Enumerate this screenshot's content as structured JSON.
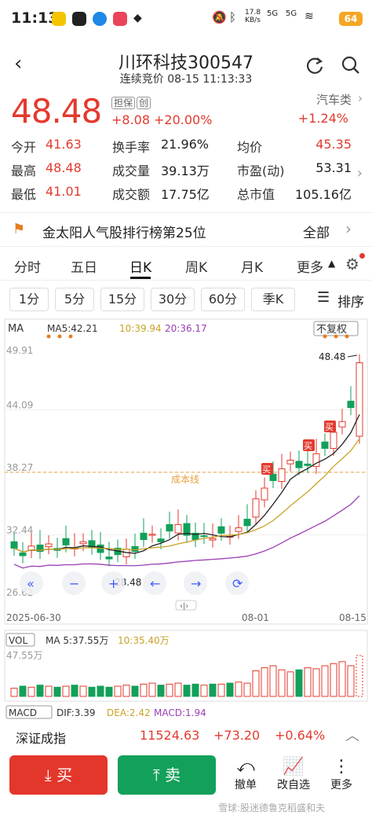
{
  "status": {
    "time": "11:13",
    "net_speed": "17.8",
    "net_unit": "KB/s",
    "sig1": "5G",
    "sig2": "5G",
    "battery": "64"
  },
  "header": {
    "title": "川环科技300547",
    "subtitle": "连续竞价 08-15 11:13:33"
  },
  "quote": {
    "price": "48.48",
    "tag1": "担保",
    "tag2": "创",
    "change": "+8.08",
    "change_pct": "+20.00%",
    "sector": "汽车类",
    "sector_pct": "+1.24%"
  },
  "stats": [
    {
      "label": "今开",
      "value": "41.63",
      "color": "red"
    },
    {
      "label": "换手率",
      "value": "21.96%",
      "color": "dark"
    },
    {
      "label": "均价",
      "value": "45.35",
      "color": "red"
    },
    {
      "label": "最高",
      "value": "48.48",
      "color": "red"
    },
    {
      "label": "成交量",
      "value": "39.13万",
      "color": "dark"
    },
    {
      "label": "市盈(动)",
      "value": "53.31",
      "color": "dark"
    },
    {
      "label": "最低",
      "value": "41.01",
      "color": "red"
    },
    {
      "label": "成交额",
      "value": "17.75亿",
      "color": "dark"
    },
    {
      "label": "总市值",
      "value": "105.16亿",
      "color": "dark"
    }
  ],
  "banner": {
    "text": "金太阳人气股排行榜第25位",
    "action": "全部"
  },
  "tabs": [
    "分时",
    "五日",
    "日K",
    "周K",
    "月K",
    "更多"
  ],
  "periods": [
    "1分",
    "5分",
    "15分",
    "30分",
    "60分",
    "季K"
  ],
  "sort_label": "排序",
  "chart": {
    "ma_label": "MA",
    "ma5": "MA5:42.21",
    "ma10": "10:39.94",
    "ma20": "20:36.17",
    "adjust": "不复权",
    "y_labels": [
      "49.91",
      "44.09",
      "38.27",
      "32.44",
      "26.62"
    ],
    "x_labels": [
      "2025-06-30",
      "08-01",
      "08-15"
    ],
    "cost_line_label": "成本线",
    "high_label": "48.48",
    "low_label": "28.48",
    "buy_label": "买",
    "vol_label": "VOL",
    "vol_ma5": "MA 5:37.55万",
    "vol_ma10": "10:35.40万",
    "vol_max": "47.55万",
    "macd_label": "MACD",
    "dif": "DIF:3.39",
    "dea": "DEA:2.42",
    "macd": "MACD:1.94"
  },
  "chart_data": {
    "type": "candlestick",
    "x": [
      "2025-06-30",
      "08-01",
      "08-15"
    ],
    "ylim": [
      26.62,
      49.91
    ],
    "last_close": 48.48,
    "ma5": 42.21,
    "ma10": 39.94,
    "ma20": 36.17
  },
  "index": {
    "name": "深证成指",
    "value": "11524.63",
    "change": "+73.20",
    "pct": "+0.64%"
  },
  "toolbar": {
    "buy": "买",
    "sell": "卖",
    "revoke": "撤单",
    "edit": "改自选",
    "more": "更多"
  },
  "watermark": "雪球:股迷德鲁克稻盛和夫"
}
